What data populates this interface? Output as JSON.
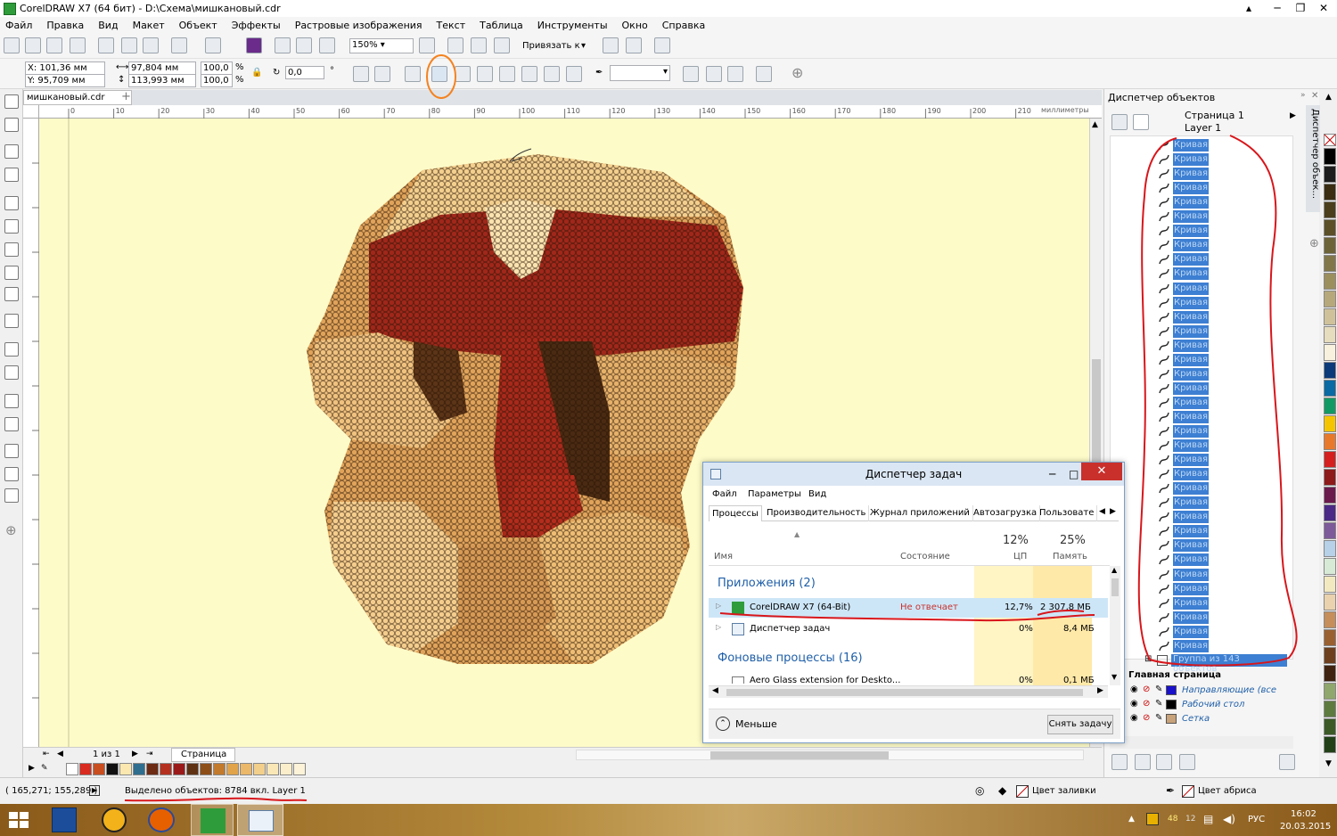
{
  "window": {
    "title": "CorelDRAW X7 (64 бит) - D:\\Схема\\мишкановый.cdr",
    "controls": [
      "minimize",
      "maximize",
      "close"
    ]
  },
  "menu": [
    "Файл",
    "Правка",
    "Вид",
    "Макет",
    "Объект",
    "Эффекты",
    "Растровые изображения",
    "Текст",
    "Таблица",
    "Инструменты",
    "Окно",
    "Справка"
  ],
  "toolbar": {
    "zoom": "150%",
    "snap_label": "Привязать к"
  },
  "property_bar": {
    "x": "X: 101,36 мм",
    "y": "Y: 95,709 мм",
    "width": "97,804 мм",
    "height": "113,993 мм",
    "scale_w": "100,0",
    "scale_h": "100,0",
    "percent": "%",
    "rotation": "0,0",
    "degree": "°"
  },
  "document": {
    "tab": "мишкановый.cdr",
    "ruler_unit": "миллиметры",
    "ruler_ticks": [
      "0",
      "10",
      "20",
      "30",
      "40",
      "50",
      "60",
      "70",
      "80",
      "90",
      "100",
      "110",
      "120",
      "130",
      "140",
      "150",
      "160",
      "170",
      "180",
      "190",
      "200",
      "210"
    ]
  },
  "page_nav": {
    "counter": "1 из 1",
    "page": "Страница 1"
  },
  "docker": {
    "title": "Диспетчер объектов",
    "page": "Страница 1",
    "layer": "Layer 1",
    "curve_label": "Кривая",
    "curve_count": 36,
    "group": "Группа из 143 объектов",
    "master": "Главная страница",
    "master_layers": [
      {
        "name": "Направляющие (все",
        "color": "#1a11cc"
      },
      {
        "name": "Рабочий стол",
        "color": "#000000"
      },
      {
        "name": "Сетка",
        "color": "#c8a27a"
      }
    ],
    "vertical_tab": "Диспетчер объек..."
  },
  "status": {
    "coords": "( 165,271; 155,289 )",
    "selection": "Выделено объектов: 8784 вкл. Layer 1",
    "fill": "Цвет заливки",
    "outline": "Цвет абриса"
  },
  "task_manager": {
    "title": "Диспетчер задач",
    "menu": [
      "Файл",
      "Параметры",
      "Вид"
    ],
    "tabs": [
      "Процессы",
      "Производительность",
      "Журнал приложений",
      "Автозагрузка",
      "Пользовате"
    ],
    "headers": {
      "name": "Имя",
      "status": "Состояние",
      "cpu_pct": "12%",
      "cpu": "ЦП",
      "mem_pct": "25%",
      "mem": "Память"
    },
    "apps_group": "Приложения (2)",
    "rows": [
      {
        "name": "CorelDRAW X7 (64-Bit)",
        "status": "Не отвечает",
        "cpu": "12,7%",
        "mem": "2 307,8 МБ"
      },
      {
        "name": "Диспетчер задач",
        "status": "",
        "cpu": "0%",
        "mem": "8,4 МБ"
      }
    ],
    "bg_group": "Фоновые процессы (16)",
    "bg_row": {
      "name": "Aero Glass extension for Deskto...",
      "cpu": "0%",
      "mem": "0,1 МБ"
    },
    "less": "Меньше",
    "end_task": "Снять задачу"
  },
  "taskbar": {
    "lang": "РУС",
    "time": "16:02",
    "date": "20.03.2015",
    "tray_a": "48",
    "tray_b": "12"
  },
  "colors": {
    "canvas": "#fdfbc8",
    "selection": "#3d7fd2",
    "annotation": "#d8161b",
    "highlight": "#f5821f"
  },
  "palette_bottom": [
    "#ffffff",
    "#d92b1f",
    "#c84d1f",
    "#111111",
    "#fbe8b0",
    "#2f6e8e",
    "#6d2b14",
    "#b6301f",
    "#9a1a1a",
    "#5f3213",
    "#8e4e17",
    "#c27a2c",
    "#e1a44a",
    "#ebb768",
    "#f2cf8a",
    "#fae7b7",
    "#fbeeca",
    "#fcf3d8"
  ],
  "palette_right": [
    "#000000",
    "#1d1d1d",
    "#3a2d12",
    "#4a3e1c",
    "#5b5028",
    "#6c6338",
    "#807649",
    "#9b8f5e",
    "#b6a87a",
    "#cfc29b",
    "#e6dcbe",
    "#f7f1de",
    "#0b3a7a",
    "#0a6aa3",
    "#129a64",
    "#f5c400",
    "#e8792b",
    "#d51f1f",
    "#8e1a1a",
    "#6b1a4e",
    "#4a2a86",
    "#7d5a9a",
    "#b6d1e8",
    "#d7ead6",
    "#f3e9c1",
    "#ead2ae",
    "#c58e5a",
    "#9a6030",
    "#6d3f1d",
    "#3f2210",
    "#8fa66c",
    "#5d7b3f",
    "#3b5a26",
    "#214018"
  ]
}
